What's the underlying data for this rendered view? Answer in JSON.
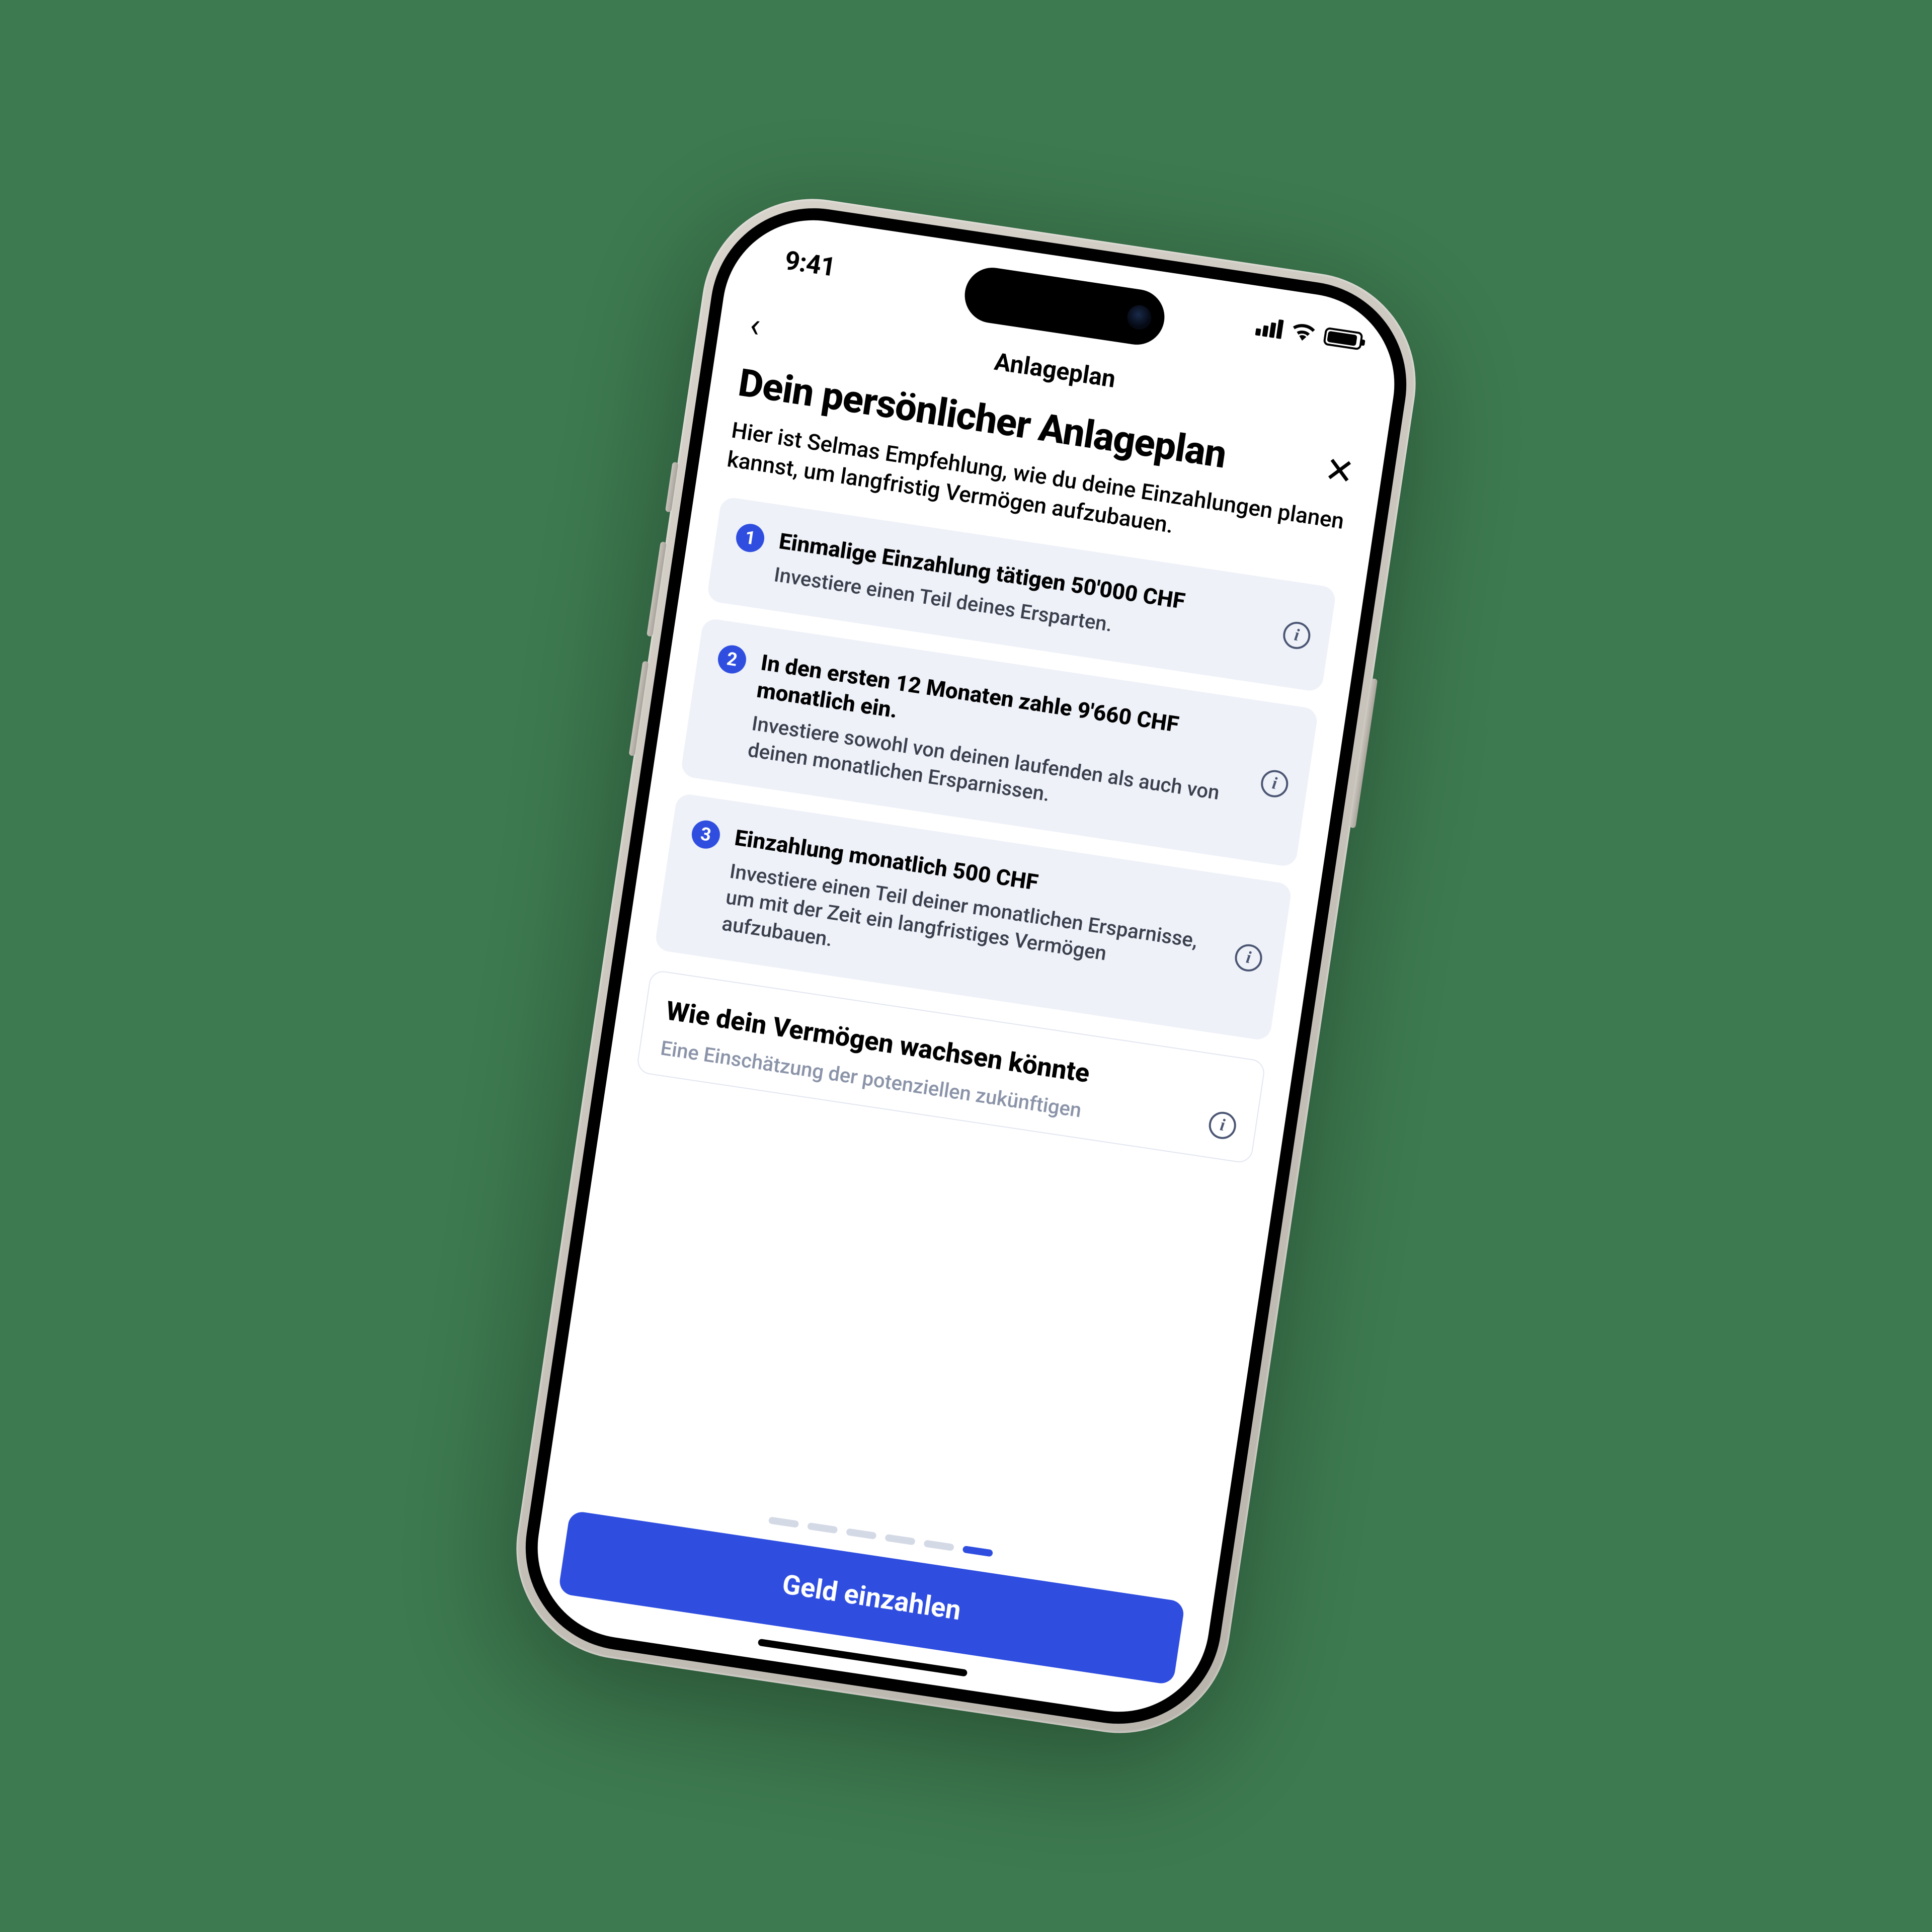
{
  "status": {
    "time": "9:41"
  },
  "nav": {
    "back": "‹",
    "title": "Anlageplan",
    "close": "✕"
  },
  "heading": "Dein persönlicher Anlageplan",
  "subtitle": "Hier ist Selmas Empfehlung, wie du deine Einzahlungen planen kannst, um langfristig Vermögen aufzubauen.",
  "steps": [
    {
      "num": "1",
      "title": "Einmalige Einzahlung tätigen 50'000 CHF",
      "desc": "Investiere einen Teil deines Ersparten."
    },
    {
      "num": "2",
      "title": "In den ersten 12 Monaten zahle 9'660 CHF monatlich ein.",
      "desc": "Investiere sowohl von deinen laufenden als auch von deinen monatlichen Ersparnissen."
    },
    {
      "num": "3",
      "title": "Einzahlung monatlich 500 CHF",
      "desc": "Investiere einen Teil deiner monatlichen Ersparnisse, um mit der Zeit ein langfristiges Vermögen aufzubauen."
    }
  ],
  "projection": {
    "title": "Wie dein Vermögen wachsen könnte",
    "sub": "Eine Einschätzung der potenziellen zukünftigen"
  },
  "cta": "Geld einzahlen",
  "pager": {
    "count": 6,
    "active": 5
  },
  "colors": {
    "accent": "#2f4ee0",
    "cardBg": "#eef1f8"
  }
}
